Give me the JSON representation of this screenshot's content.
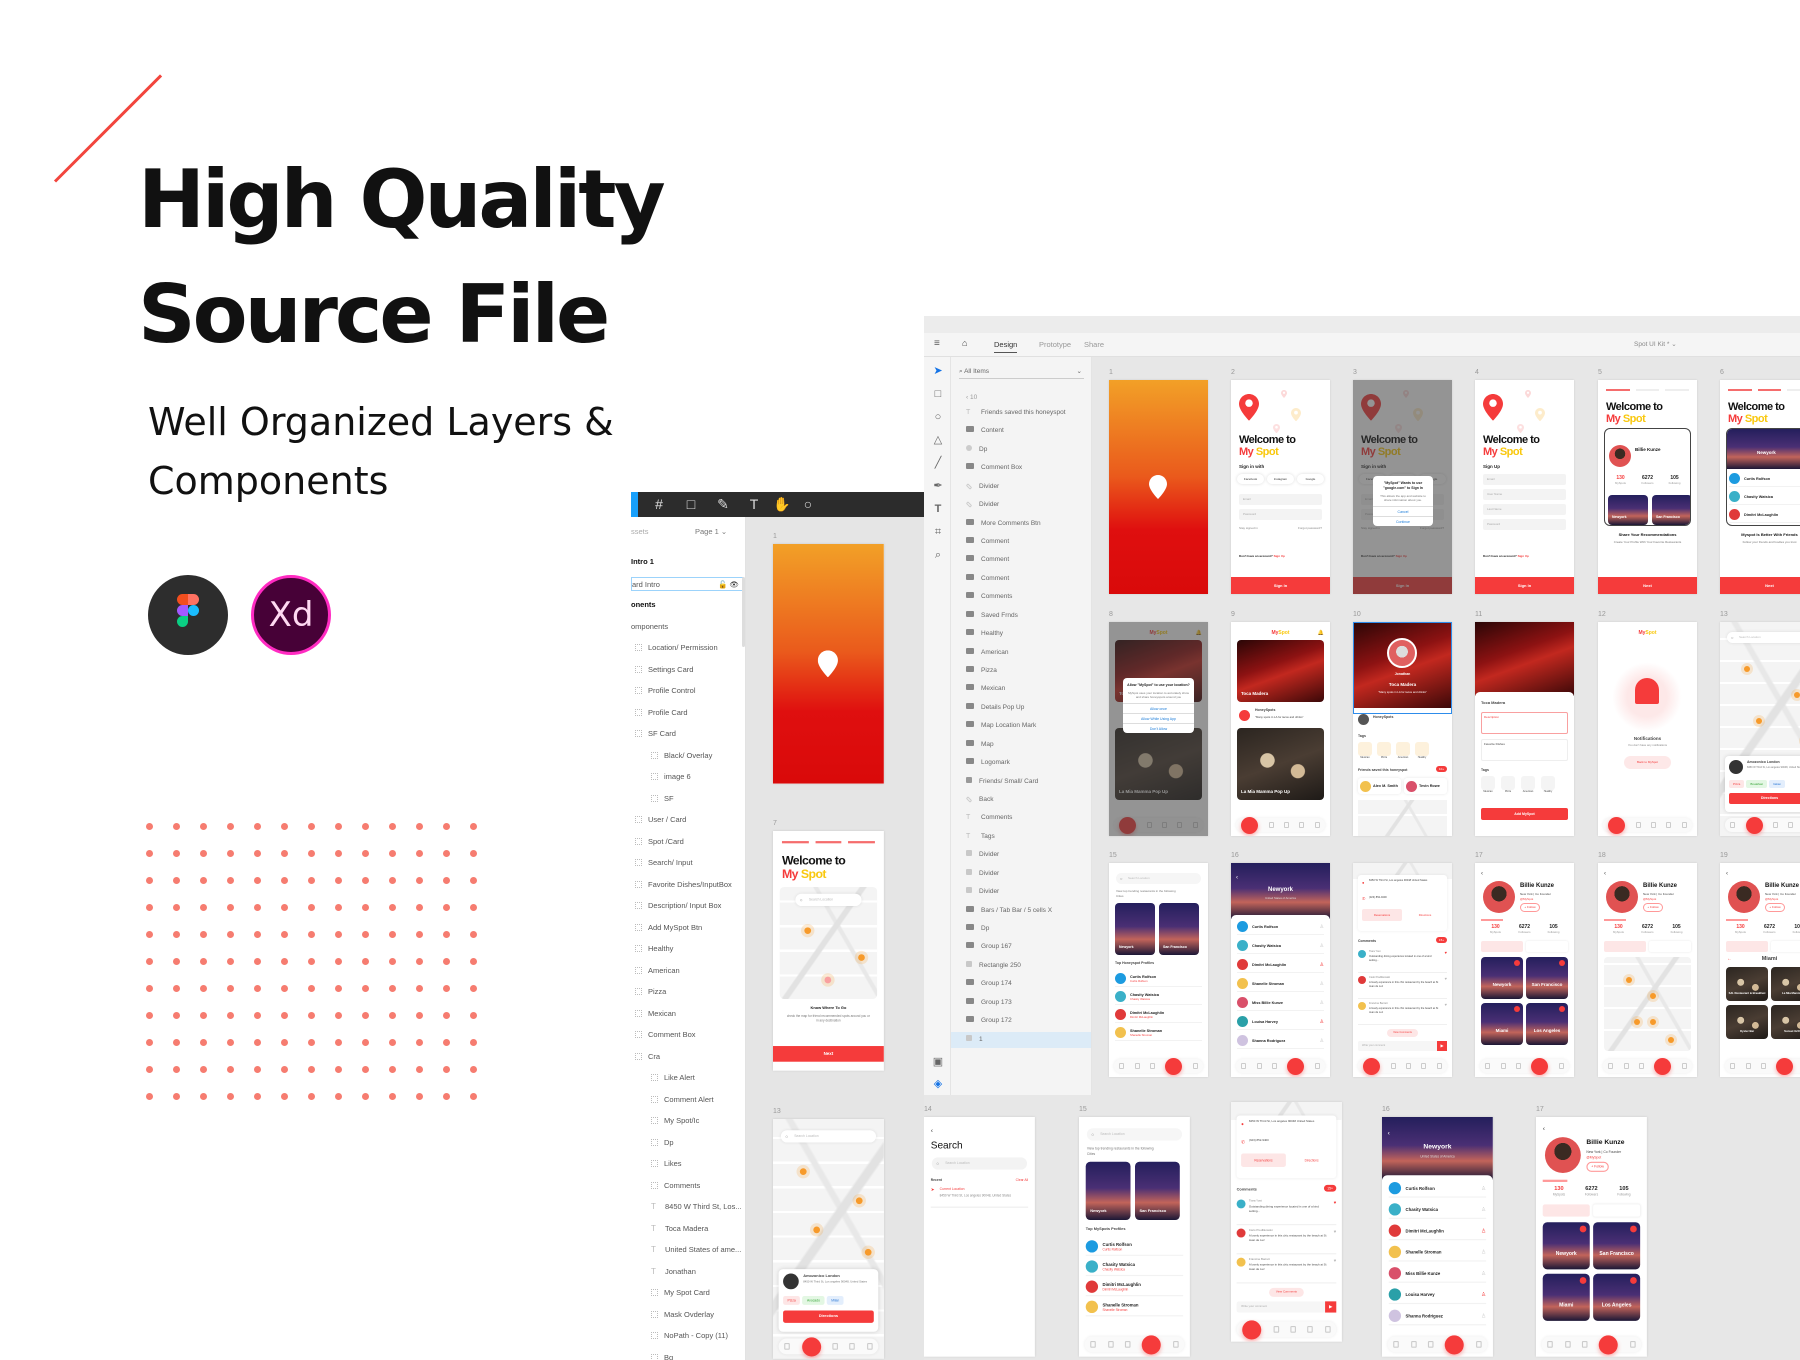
{
  "hero": {
    "title_line1": "High Quality",
    "title_line2": "Source File",
    "subtitle_line1": "Well Organized Layers &",
    "subtitle_line2": "Components",
    "accent_color": "#f2453d",
    "dot_color": "#f67c70"
  },
  "tool_logos": [
    {
      "name": "Figma",
      "icon": "figma-logo"
    },
    {
      "name": "Adobe XD",
      "label": "Xd",
      "icon": "xd-logo"
    }
  ],
  "figma": {
    "toolbar_icons": [
      "frame-icon",
      "rectangle-icon",
      "pen-icon",
      "text-icon",
      "hand-icon",
      "comment-icon"
    ],
    "panel_tab": "ssets",
    "page": "Page 1 ⌄",
    "layers": [
      {
        "label": "Intro 1",
        "type": "none",
        "indent": 0,
        "bold": true
      },
      {
        "label": "ard Intro",
        "type": "none",
        "indent": 0,
        "selected": true
      },
      {
        "label": "onents",
        "type": "none",
        "indent": 0,
        "bold": true
      },
      {
        "label": "omponents",
        "type": "none",
        "indent": 0
      },
      {
        "label": "Location/ Permission",
        "type": "frame",
        "indent": 1
      },
      {
        "label": "Settings Card",
        "type": "frame",
        "indent": 1
      },
      {
        "label": "Profile Control",
        "type": "frame",
        "indent": 1
      },
      {
        "label": "Profile Card",
        "type": "frame",
        "indent": 1
      },
      {
        "label": "SF Card",
        "type": "frame",
        "indent": 1
      },
      {
        "label": "Black/ Overlay",
        "type": "frame",
        "indent": 2
      },
      {
        "label": "image 6",
        "type": "image",
        "indent": 2
      },
      {
        "label": "SF",
        "type": "frame",
        "indent": 2
      },
      {
        "label": "User / Card",
        "type": "frame",
        "indent": 1
      },
      {
        "label": "Spot /Card",
        "type": "frame",
        "indent": 1
      },
      {
        "label": "Search/ Input",
        "type": "frame",
        "indent": 1
      },
      {
        "label": "Favorite Dishes/InputBox",
        "type": "frame",
        "indent": 1
      },
      {
        "label": "Description/ Input Box",
        "type": "frame",
        "indent": 1
      },
      {
        "label": "Add MySpot Btn",
        "type": "frame",
        "indent": 1
      },
      {
        "label": "Healthy",
        "type": "frame",
        "indent": 1
      },
      {
        "label": "American",
        "type": "frame",
        "indent": 1
      },
      {
        "label": "Pizza",
        "type": "frame",
        "indent": 1
      },
      {
        "label": "Mexican",
        "type": "frame",
        "indent": 1
      },
      {
        "label": "Comment Box",
        "type": "frame",
        "indent": 1
      },
      {
        "label": "Cra",
        "type": "frame",
        "indent": 1
      },
      {
        "label": "Like Alert",
        "type": "frame",
        "indent": 2
      },
      {
        "label": "Comment Alert",
        "type": "frame",
        "indent": 2
      },
      {
        "label": "My Spot/Ic",
        "type": "frame",
        "indent": 2
      },
      {
        "label": "Dp",
        "type": "frame",
        "indent": 2
      },
      {
        "label": "Likes",
        "type": "frame",
        "indent": 2
      },
      {
        "label": "Comments",
        "type": "frame",
        "indent": 2
      },
      {
        "label": "8450 W Third St, Los...",
        "type": "text",
        "indent": 2
      },
      {
        "label": "Toca Madera",
        "type": "text",
        "indent": 2
      },
      {
        "label": "United States of ame...",
        "type": "text",
        "indent": 2
      },
      {
        "label": "Jonathan",
        "type": "text",
        "indent": 2
      },
      {
        "label": "My Spot Card",
        "type": "frame",
        "indent": 2
      },
      {
        "label": "Mask Ovderlay",
        "type": "rect",
        "indent": 2
      },
      {
        "label": "NoPath - Copy (11)",
        "type": "image",
        "indent": 2
      },
      {
        "label": "Bg",
        "type": "frame",
        "indent": 2
      }
    ],
    "artboards": [
      {
        "label": "1",
        "kind": "splash"
      },
      {
        "label": "7",
        "kind": "onboard_map",
        "progress": 3,
        "heading": "Welcome to",
        "brand_my": "My",
        "brand_spot": "Spot",
        "search": "Search Location",
        "caption": "Know Where To Go",
        "desc": "check the map for friend recommended spots around you or in any destination",
        "button": "Next"
      },
      {
        "label": "13",
        "kind": "map",
        "search": "Search Location",
        "place": "Amozonico London",
        "address": "8450 W Third St, Los angeles 90048, United States",
        "tags": [
          "Pizza",
          "Avocado",
          "Milan"
        ],
        "button": "Directions",
        "active_tab": 1
      }
    ]
  },
  "xd": {
    "tabs": [
      "Design",
      "Prototype",
      "Share"
    ],
    "active_tab": "Design",
    "doc_title": "Spot UI Kit * ⌄",
    "layers_filter": "All Items",
    "back_label": "‹  10",
    "tool_icons": [
      "select-icon",
      "rectangle-icon",
      "ellipse-icon",
      "polygon-icon",
      "line-icon",
      "pen-icon",
      "text-icon",
      "artboard-icon",
      "zoom-icon"
    ],
    "layers": [
      {
        "label": "Friends saved this honeyspot",
        "type": "text"
      },
      {
        "label": "Content",
        "type": "group"
      },
      {
        "label": "Dp",
        "type": "ellipse"
      },
      {
        "label": "Comment Box",
        "type": "group"
      },
      {
        "label": "Divider",
        "type": "path"
      },
      {
        "label": "Divider",
        "type": "path"
      },
      {
        "label": "More Comments Btn",
        "type": "group"
      },
      {
        "label": "Comment",
        "type": "group"
      },
      {
        "label": "Comment",
        "type": "group"
      },
      {
        "label": "Comment",
        "type": "group"
      },
      {
        "label": "Comments",
        "type": "group"
      },
      {
        "label": "Saved Frnds",
        "type": "group"
      },
      {
        "label": "Healthy",
        "type": "group"
      },
      {
        "label": "American",
        "type": "group"
      },
      {
        "label": "Pizza",
        "type": "group"
      },
      {
        "label": "Mexican",
        "type": "group"
      },
      {
        "label": "Details Pop Up",
        "type": "group"
      },
      {
        "label": "Map Location Mark",
        "type": "group"
      },
      {
        "label": "Map",
        "type": "group"
      },
      {
        "label": "Logomark",
        "type": "group"
      },
      {
        "label": "Friends/ Small/ Card",
        "type": "symbol"
      },
      {
        "label": "Back",
        "type": "path"
      },
      {
        "label": "Comments",
        "type": "text"
      },
      {
        "label": "Tags",
        "type": "text"
      },
      {
        "label": "Divider",
        "type": "rect"
      },
      {
        "label": "Divider",
        "type": "rect"
      },
      {
        "label": "Divider",
        "type": "rect"
      },
      {
        "label": "Bars / Tab Bar / 5 cells X",
        "type": "group"
      },
      {
        "label": "Dp",
        "type": "group"
      },
      {
        "label": "Group 167",
        "type": "group"
      },
      {
        "label": "Rectangle 250",
        "type": "rect"
      },
      {
        "label": "Group 174",
        "type": "group"
      },
      {
        "label": "Group 173",
        "type": "group"
      },
      {
        "label": "Group 172",
        "type": "group"
      },
      {
        "label": "1",
        "type": "rect",
        "selected": true
      }
    ],
    "artboards": [
      {
        "label": "1",
        "kind": "splash"
      },
      {
        "label": "2",
        "kind": "welcome",
        "heading": "Welcome to",
        "brand_my": "My",
        "brand_spot": "Spot",
        "section": "Sign in with",
        "social": [
          "Facebook",
          "Instagram",
          "Google"
        ],
        "fields": [
          "Email",
          "Password"
        ],
        "remember": "Stay signed in",
        "forgot": "Forgot password?",
        "prompt": "Don't have an account?",
        "link": "Sign Up",
        "button": "Sign In"
      },
      {
        "label": "3",
        "kind": "welcome",
        "heading": "Welcome to",
        "brand_my": "My",
        "brand_spot": "Spot",
        "section": "Sign in with",
        "social": [
          "Facebook",
          "Instagram",
          "Google"
        ],
        "fields": [
          "Email",
          "Password"
        ],
        "remember": "Stay signed in",
        "forgot": "Forgot password?",
        "prompt": "Don't have an account?",
        "link": "Sign Up",
        "button": "Sign In",
        "dialog": {
          "title": "\"MySpot\" Wants to use \"google.com\" to Sign In",
          "desc": "This allows the app and website to share information about you.",
          "buttons": [
            "Cancel",
            "Continue"
          ]
        }
      },
      {
        "label": "4",
        "kind": "welcome",
        "heading": "Welcome to",
        "brand_my": "My",
        "brand_spot": "Spot",
        "section": "Sign Up",
        "fields": [
          "Email",
          "User Name",
          "Last Name",
          "Password"
        ],
        "prompt": "Don't have an account?",
        "link": "Sign Up",
        "button": "Sign In"
      },
      {
        "label": "5",
        "kind": "onboard_profile",
        "progress": 1,
        "heading": "Welcome to",
        "brand_my": "My",
        "brand_spot": "Spot",
        "name": "Billie Kunze",
        "stats": [
          {
            "value": "130",
            "label": "MySpots"
          },
          {
            "value": "6272",
            "label": "Followers"
          },
          {
            "value": "105",
            "label": "Following"
          }
        ],
        "cities": [
          "Newyork",
          "San Francisco"
        ],
        "caption": "Share Your Recommendations",
        "desc": "Create Your Profile With Your Favorite Restaurants",
        "button": "Next"
      },
      {
        "label": "6",
        "kind": "onboard_city",
        "progress": 2,
        "heading": "Welcome to",
        "brand_my": "My",
        "brand_spot": "Spot",
        "city": "Newyork",
        "people": [
          "Curtis Rolfson",
          "Chasity Watsica",
          "Dimitri McLaughlin"
        ],
        "caption": "Myspot Is Better With Friends",
        "desc": "Follow your friends and foodies you trust",
        "button": "Next"
      },
      {
        "label": "8",
        "kind": "feed",
        "brand_my": "My",
        "brand_spot": "Spot",
        "spots": [
          "Toca Madera",
          "La Mia Mamma Pop Up"
        ],
        "active_tab": 0,
        "dialog": {
          "title": "Allow \"MySpot\" to use your location?",
          "desc": "MySpot uses your location to accurately show and share honeyspots around you",
          "buttons": [
            "Allow once",
            "Allow While Using App",
            "Don't Allow"
          ]
        }
      },
      {
        "label": "9",
        "kind": "feed",
        "brand_my": "My",
        "brand_spot": "Spot",
        "spots": [
          "Toca Madera",
          "La Mia Mamma Pop Up"
        ],
        "honeyspot": "HoneySpots",
        "quote": "\"Many spots in LA for tacos and drinks\"",
        "active_tab": 0
      },
      {
        "label": "10",
        "kind": "detail",
        "user": "Jonathan",
        "spot": "Toca Madera",
        "quote": "\"Many spots in LA for tacos and drinks\"",
        "section1": "HoneySpots",
        "tags_title": "Tags",
        "tags": [
          "Mexican",
          "Pizza",
          "American",
          "Healthy"
        ],
        "friends_title": "Friends saved this honeyspot",
        "badge": "10+",
        "friends": [
          "Alex M. Smith",
          "Tevin Rowe"
        ]
      },
      {
        "label": "11",
        "kind": "addspot",
        "spot": "Toca Madera",
        "fields": [
          "Description",
          "Favorite Dishes"
        ],
        "tags_title": "Tags",
        "tags": [
          "Mexican",
          "Pizza",
          "American",
          "Healthy"
        ],
        "button": "Add MySpot"
      },
      {
        "label": "12",
        "kind": "notif",
        "brand_my": "My",
        "brand_spot": "Spot",
        "title": "Notifications",
        "desc": "You don't have any notifications",
        "button": "Back to MySpot",
        "active_tab": 0
      },
      {
        "label": "13",
        "kind": "map",
        "search": "Search Location",
        "place": "Amozonico London",
        "address": "8450 W Third St, Los angeles 90048, United States",
        "tags": [
          "Pizza",
          "Breakfast",
          "Italian"
        ],
        "button": "Directions",
        "active_tab": 1
      },
      {
        "label": "15",
        "kind": "cities",
        "search": "Search Location",
        "desc": "View top trending restaurants in the following Cities",
        "cities": [
          "Newyork",
          "San Francisco"
        ],
        "section": "Top Honeyspot Profiles",
        "people": [
          "Curtis Rolfson",
          "Chasity Watsica",
          "Dimitri McLaughlin",
          "Shanelle Stroman"
        ],
        "active_tab": 3
      },
      {
        "label": "16",
        "kind": "city",
        "city": "Newyork",
        "country": "United States of America",
        "people": [
          "Curtis Rolfson",
          "Chasity Watsica",
          "Dimitri McLaughlin",
          "Shanelle Stroman",
          "Miss Billie Kunze",
          "Louisa Harvey",
          "Shanna Rodriguez"
        ],
        "active_tab": 3
      },
      {
        "label": "",
        "kind": "comments",
        "address": "8450 W Third St, Los angeles 90048 United States",
        "phone": "(323) 852-9400",
        "buttons": [
          "Reservations",
          "Directions"
        ],
        "title": "Comments",
        "badge": "15+",
        "comments": [
          {
            "name": "Tiara Yost",
            "text": "Outstanding dining experience located in one of a kind setting..."
          },
          {
            "name": "Cielo Predlikowski",
            "text": "A lovely experience in this chic restaurant by the beach at St Jean de Luz"
          },
          {
            "name": "Francine Barrett",
            "text": "A lovely experience in this chic restaurant by the beach at St Jean de Luz"
          }
        ],
        "more": "View Comments",
        "input": "Write your comment",
        "active_tab": 0
      },
      {
        "label": "17",
        "kind": "profile",
        "name": "Billie Kunze",
        "role": "New York | Co Founder",
        "handle": "@MySpot",
        "follow": "+ Follow",
        "stats": [
          {
            "value": "130",
            "label": "MySpots"
          },
          {
            "value": "6272",
            "label": "Followers"
          },
          {
            "value": "105",
            "label": "Following"
          }
        ],
        "cities": [
          "Newyork",
          "San Francisco",
          "Miami",
          "Los Angeles"
        ],
        "active_tab": 3
      },
      {
        "label": "18",
        "kind": "profile_map",
        "name": "Billie Kunze",
        "role": "New York | Co Founder",
        "handle": "@MySpot",
        "follow": "+ Follow",
        "stats": [
          {
            "value": "130",
            "label": "MySpots"
          },
          {
            "value": "6272",
            "label": "Followers"
          },
          {
            "value": "105",
            "label": "Following"
          }
        ],
        "active_tab": 3
      },
      {
        "label": "19",
        "kind": "profile_city",
        "name": "Billie Kunze",
        "role": "New York | Co Founder",
        "handle": "@MySpot",
        "follow": "+ Follow",
        "stats": [
          {
            "value": "130",
            "label": "MySpots"
          },
          {
            "value": "6272",
            "label": "Followers"
          },
          {
            "value": "105",
            "label": "Following"
          }
        ],
        "city": "Miami",
        "spots": [
          "SJL Restaurant & Breakfast",
          "La Mia Mamma",
          "Oyster Bar",
          "Sunset Grill"
        ],
        "active_tab": 3
      },
      {
        "label": "14",
        "kind": "search",
        "back": "‹",
        "title": "Search",
        "search": "Search Location",
        "recent": "Recent",
        "clear": "Clear All",
        "current": "Current Location",
        "address": "8450 W Third St, Los angeles 90048, United States"
      },
      {
        "label": "15",
        "kind": "cities",
        "search": "Search Location",
        "desc": "View top trending restaurants in the following Cities",
        "cities": [
          "Newyork",
          "San Francisco"
        ],
        "section": "Top MySpots Profiles",
        "people": [
          "Curtis Rolfson",
          "Chasity Watsica",
          "Dimitri McLaughlin",
          "Shanelle Stroman"
        ],
        "active_tab": 3
      },
      {
        "label": "",
        "kind": "comments",
        "address": "8450 W Third St, Los angeles 90048 United States",
        "phone": "(323) 852-9400",
        "buttons": [
          "Reservations",
          "Directions"
        ],
        "title": "Comments",
        "badge": "15+",
        "comments": [
          {
            "name": "Tiara Yost",
            "text": "Outstanding dining experience located in one of a kind setting..."
          },
          {
            "name": "Cielo Predlikowski",
            "text": "A lovely experience in this chic restaurant by the beach at St Jean de Luz"
          },
          {
            "name": "Francine Barrett",
            "text": "A lovely experience in this chic restaurant by the beach at St Jean de Luz"
          }
        ],
        "more": "View Comments",
        "input": "Write your comment",
        "active_tab": 0
      },
      {
        "label": "16",
        "kind": "city",
        "city": "Newyork",
        "country": "United States of America",
        "people": [
          "Curtis Rolfson",
          "Chasity Watsica",
          "Dimitri McLaughlin",
          "Shanelle Stroman",
          "Miss Billie Kunze",
          "Louisa Harvey",
          "Shanna Rodriguez"
        ],
        "active_tab": 3
      },
      {
        "label": "17",
        "kind": "profile",
        "name": "Billie Kunze",
        "role": "New York | Co Founder",
        "handle": "@MySpot",
        "follow": "+ Follow",
        "stats": [
          {
            "value": "130",
            "label": "MySpots"
          },
          {
            "value": "6272",
            "label": "Followers"
          },
          {
            "value": "105",
            "label": "Following"
          }
        ],
        "cities": [
          "Newyork",
          "San Francisco",
          "Miami",
          "Los Angeles"
        ],
        "active_tab": 3
      }
    ]
  },
  "colors": {
    "brand_red": "#f53b3b",
    "brand_yellow": "#f9c80e",
    "figma_blue": "#18a0fb",
    "xd_pink": "#ff2bc2",
    "xd_bg": "#470137"
  }
}
